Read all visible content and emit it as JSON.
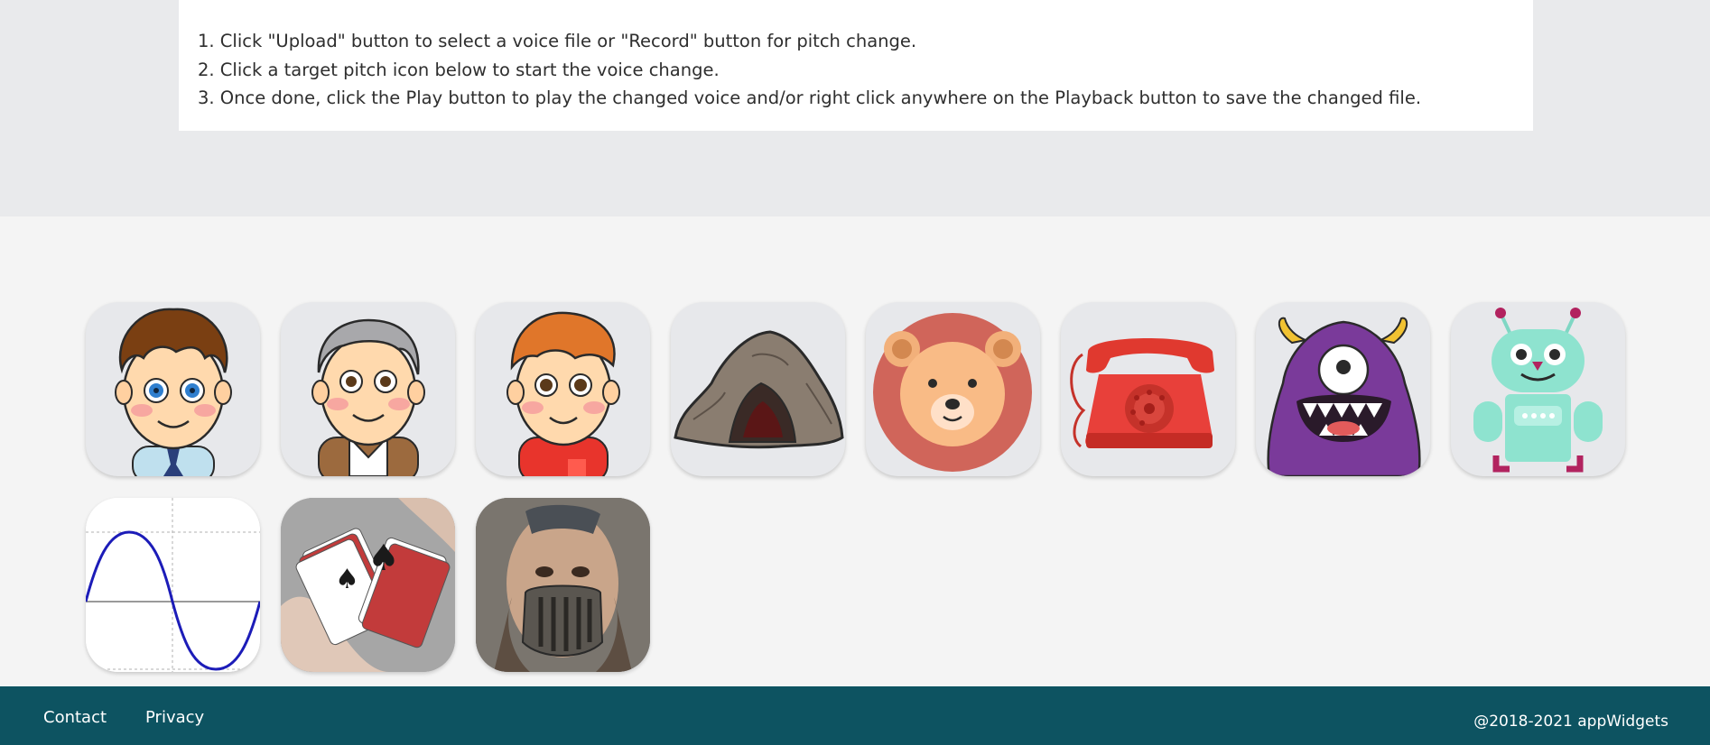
{
  "instructions": [
    "1. Click \"Upload\" button to select a voice file or \"Record\" button for pitch change.",
    "2. Click a target pitch icon below to start the voice change.",
    "3. Once done, click the Play button to play the changed voice and/or right click anywhere on the Playback button to save the changed file."
  ],
  "pitch_icons": [
    {
      "icon": "curly-hair-man-icon"
    },
    {
      "icon": "old-man-icon"
    },
    {
      "icon": "boy-icon"
    },
    {
      "icon": "cave-icon"
    },
    {
      "icon": "bear-icon"
    },
    {
      "icon": "telephone-icon"
    },
    {
      "icon": "monster-icon"
    },
    {
      "icon": "robot-icon"
    },
    {
      "icon": "sine-wave-icon"
    },
    {
      "icon": "cards-shuffle-icon"
    },
    {
      "icon": "masked-man-icon"
    }
  ],
  "footer": {
    "contact": "Contact",
    "privacy": "Privacy",
    "copyright": "@2018-2021 appWidgets"
  },
  "colors": {
    "footer_bg": "#0d5361",
    "top_band_bg": "#e9eaec",
    "page_bg": "#f4f4f4"
  }
}
